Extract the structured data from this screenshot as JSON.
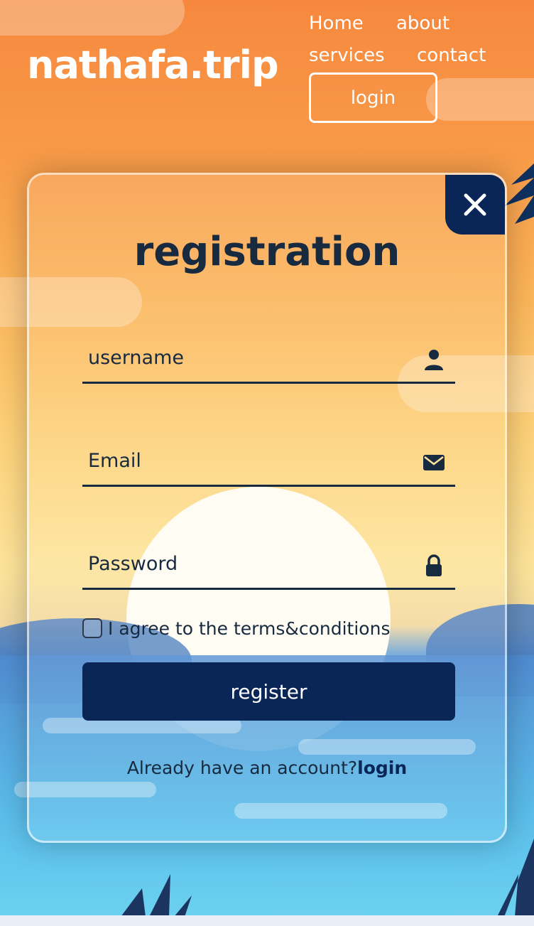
{
  "header": {
    "brand": "nathafa.trip",
    "nav": {
      "home": "Home",
      "about": "about",
      "services": "services",
      "contact": "contact",
      "login": "login"
    }
  },
  "modal": {
    "title": "registration",
    "fields": {
      "username": {
        "placeholder": "username",
        "icon": "user-icon"
      },
      "email": {
        "placeholder": "Email",
        "icon": "envelope-icon"
      },
      "password": {
        "placeholder": "Password",
        "icon": "lock-icon"
      }
    },
    "agree_label": "I agree to the terms&conditions",
    "agree_checked": false,
    "register_label": "register",
    "footer_text": "Already have an account?",
    "footer_link": "login",
    "close_icon": "close-icon"
  },
  "colors": {
    "accent_dark": "#0a2657",
    "text_dark": "#172a3f",
    "header_text": "#ffffff"
  }
}
